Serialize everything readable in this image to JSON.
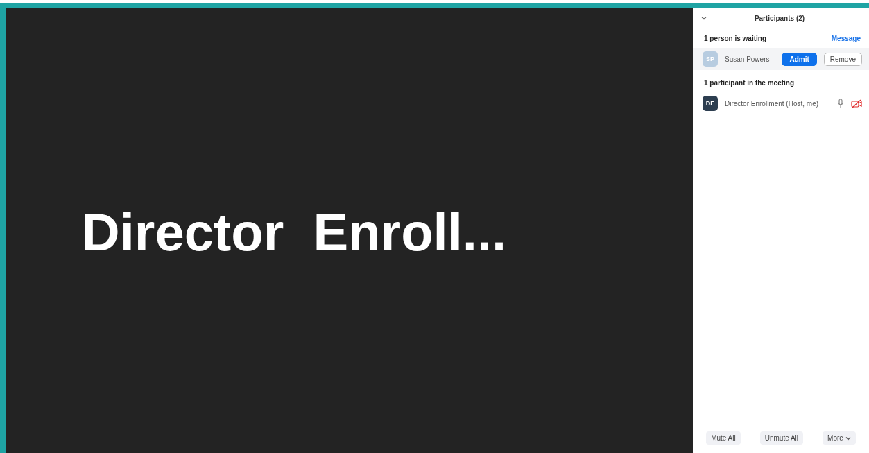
{
  "video": {
    "name": "Director  Enroll..."
  },
  "panel": {
    "title": "Participants (2)",
    "waiting_heading": "1 person is waiting",
    "message_link": "Message",
    "waiting": [
      {
        "initials": "SP",
        "name": "Susan Powers",
        "color": "#b7cce0",
        "admit": "Admit",
        "remove": "Remove"
      }
    ],
    "meeting_heading": "1 participant in the meeting",
    "participants": [
      {
        "initials": "DE",
        "name": "Director Enrollment (Host, me)",
        "color": "#2d3e50",
        "muted": false,
        "video_on": false
      }
    ],
    "footer_buttons": [
      {
        "label": "Mute All",
        "kind": "plain"
      },
      {
        "label": "Unmute All",
        "kind": "plain"
      },
      {
        "label": "More",
        "kind": "menu"
      }
    ]
  }
}
